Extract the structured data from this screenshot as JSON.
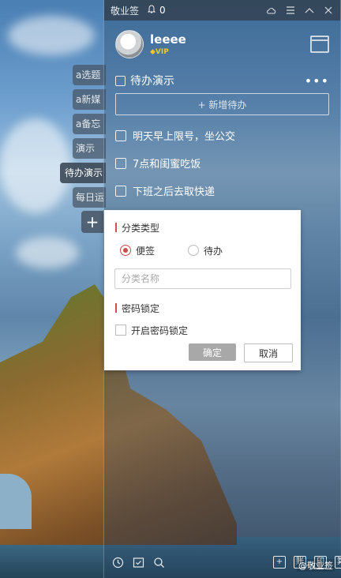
{
  "window": {
    "app_title": "敬业签",
    "reminder_count": "0",
    "controls": [
      "cloud-icon",
      "menu-icon",
      "minimize-icon",
      "close-icon"
    ]
  },
  "user": {
    "name": "leeee",
    "badge": "VIP"
  },
  "side_tabs": [
    {
      "label": "a选题",
      "active": false
    },
    {
      "label": "a新媒",
      "active": false
    },
    {
      "label": "a备忘",
      "active": false
    },
    {
      "label": "演示",
      "active": false
    },
    {
      "label": "待办演示",
      "active": true
    },
    {
      "label": "每日运",
      "active": false
    }
  ],
  "add_tab_label": "+",
  "category": {
    "title": "待办演示",
    "more": "•••"
  },
  "add_todo_label": "+ 新增待办",
  "todos": [
    "明天早上限号，坐公交",
    "7点和闺蜜吃饭",
    "下班之后去取快递"
  ],
  "dialog": {
    "section_type": "分类类型",
    "radio_memo": "便签",
    "radio_todo": "待办",
    "name_placeholder": "分类名称",
    "section_lock": "密码锁定",
    "lock_checkbox_label": "开启密码锁定",
    "ok_label": "确定",
    "cancel_label": "取消"
  },
  "toolbar_right": [
    "+",
    "账",
    "印",
    "算"
  ],
  "watermark": "@敬业签",
  "colors": {
    "accent_red": "#d24b4b",
    "titlebar_bg": "#3a4552",
    "vip_gold": "#f3c623"
  }
}
